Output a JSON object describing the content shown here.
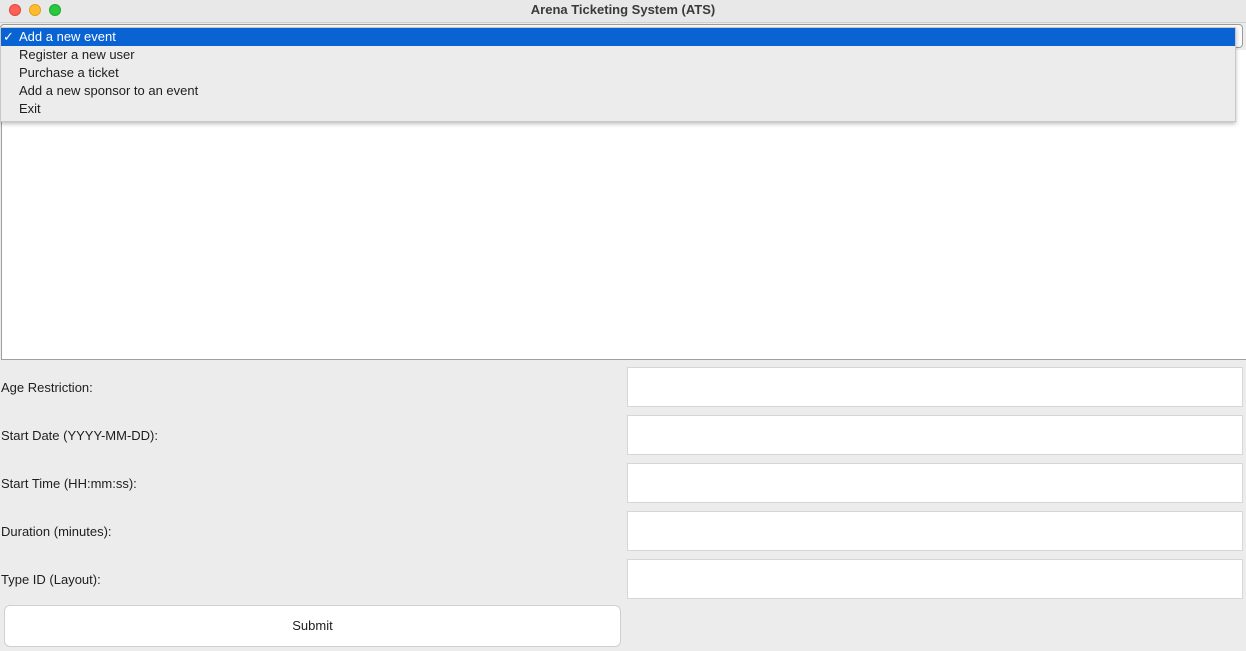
{
  "window": {
    "title": "Arena Ticketing System (ATS)"
  },
  "menu": {
    "check_mark": "✓",
    "items": [
      {
        "label": "Add a new event",
        "selected": true
      },
      {
        "label": "Register a new user",
        "selected": false
      },
      {
        "label": "Purchase a ticket",
        "selected": false
      },
      {
        "label": "Add a new sponsor to an event",
        "selected": false
      },
      {
        "label": "Exit",
        "selected": false
      }
    ]
  },
  "form": {
    "fields": [
      {
        "label": "Age Restriction:",
        "value": ""
      },
      {
        "label": "Start Date (YYYY-MM-DD):",
        "value": ""
      },
      {
        "label": "Start Time (HH:mm:ss):",
        "value": ""
      },
      {
        "label": "Duration (minutes):",
        "value": ""
      },
      {
        "label": "Type ID (Layout):",
        "value": ""
      }
    ],
    "submit_label": "Submit"
  },
  "colors": {
    "selection": "#0a63d2",
    "background": "#ececec"
  }
}
